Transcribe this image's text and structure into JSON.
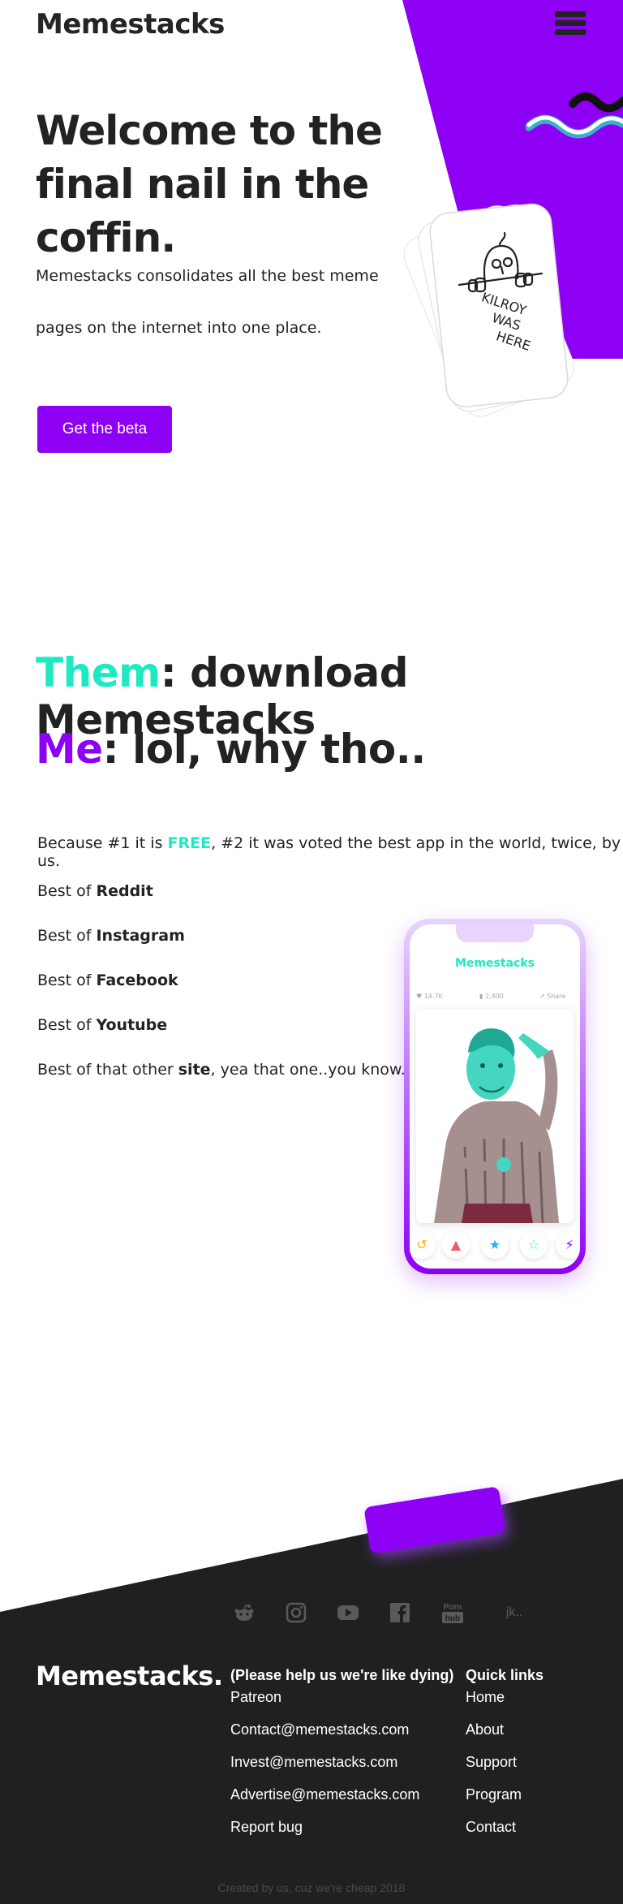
{
  "header": {
    "logo": "Memestacks"
  },
  "hero": {
    "title_part1": "Welcome to the final nail in the ",
    "title_highlight": "coffin.",
    "subtitle": "Memestacks consolidates all the best meme pages on the internet into one place.",
    "cta": "Get the beta",
    "card_text_line1": "KILROY",
    "card_text_line2": "WAS",
    "card_text_line3": "HERE"
  },
  "conversation": {
    "them_label": "Them",
    "them_text": ": download Memestacks",
    "me_label": "Me",
    "me_text": ": lol, why tho.."
  },
  "reasons": {
    "prefix": "Because #1 it is ",
    "free": "FREE",
    "suffix": ",  #2 it was voted the best app in the world, twice, by us."
  },
  "best_of": [
    {
      "prefix": "Best of ",
      "name": "Reddit",
      "suffix": ""
    },
    {
      "prefix": "Best of ",
      "name": "Instagram",
      "suffix": ""
    },
    {
      "prefix": "Best of ",
      "name": "Facebook",
      "suffix": ""
    },
    {
      "prefix": "Best of ",
      "name": "Youtube",
      "suffix": ""
    },
    {
      "prefix": "Best of that other ",
      "name": "site",
      "suffix": ", yea that one..you know."
    }
  ],
  "phone": {
    "app_name": "Memestacks",
    "likes": "14.7K",
    "comments": "2,400",
    "share": "Share"
  },
  "social": {
    "porn_line1": "Porn",
    "porn_line2": "hub",
    "jk": "jk.."
  },
  "footer": {
    "logo": "Memestacks.",
    "help_heading": "(Please help us we're like dying)",
    "help_links": [
      "Patreon",
      "Contact@memestacks.com",
      "Invest@memestacks.com",
      "Advertise@memestacks.com",
      "Report bug"
    ],
    "quick_heading": "Quick links",
    "quick_links": [
      "Home",
      "About",
      "Support",
      "Program",
      "Contact"
    ],
    "copyright": "Created by us, cuz we're cheap 2018"
  },
  "colors": {
    "purple": "#8e00f3",
    "teal": "#1de9c2",
    "dark": "#202020"
  }
}
